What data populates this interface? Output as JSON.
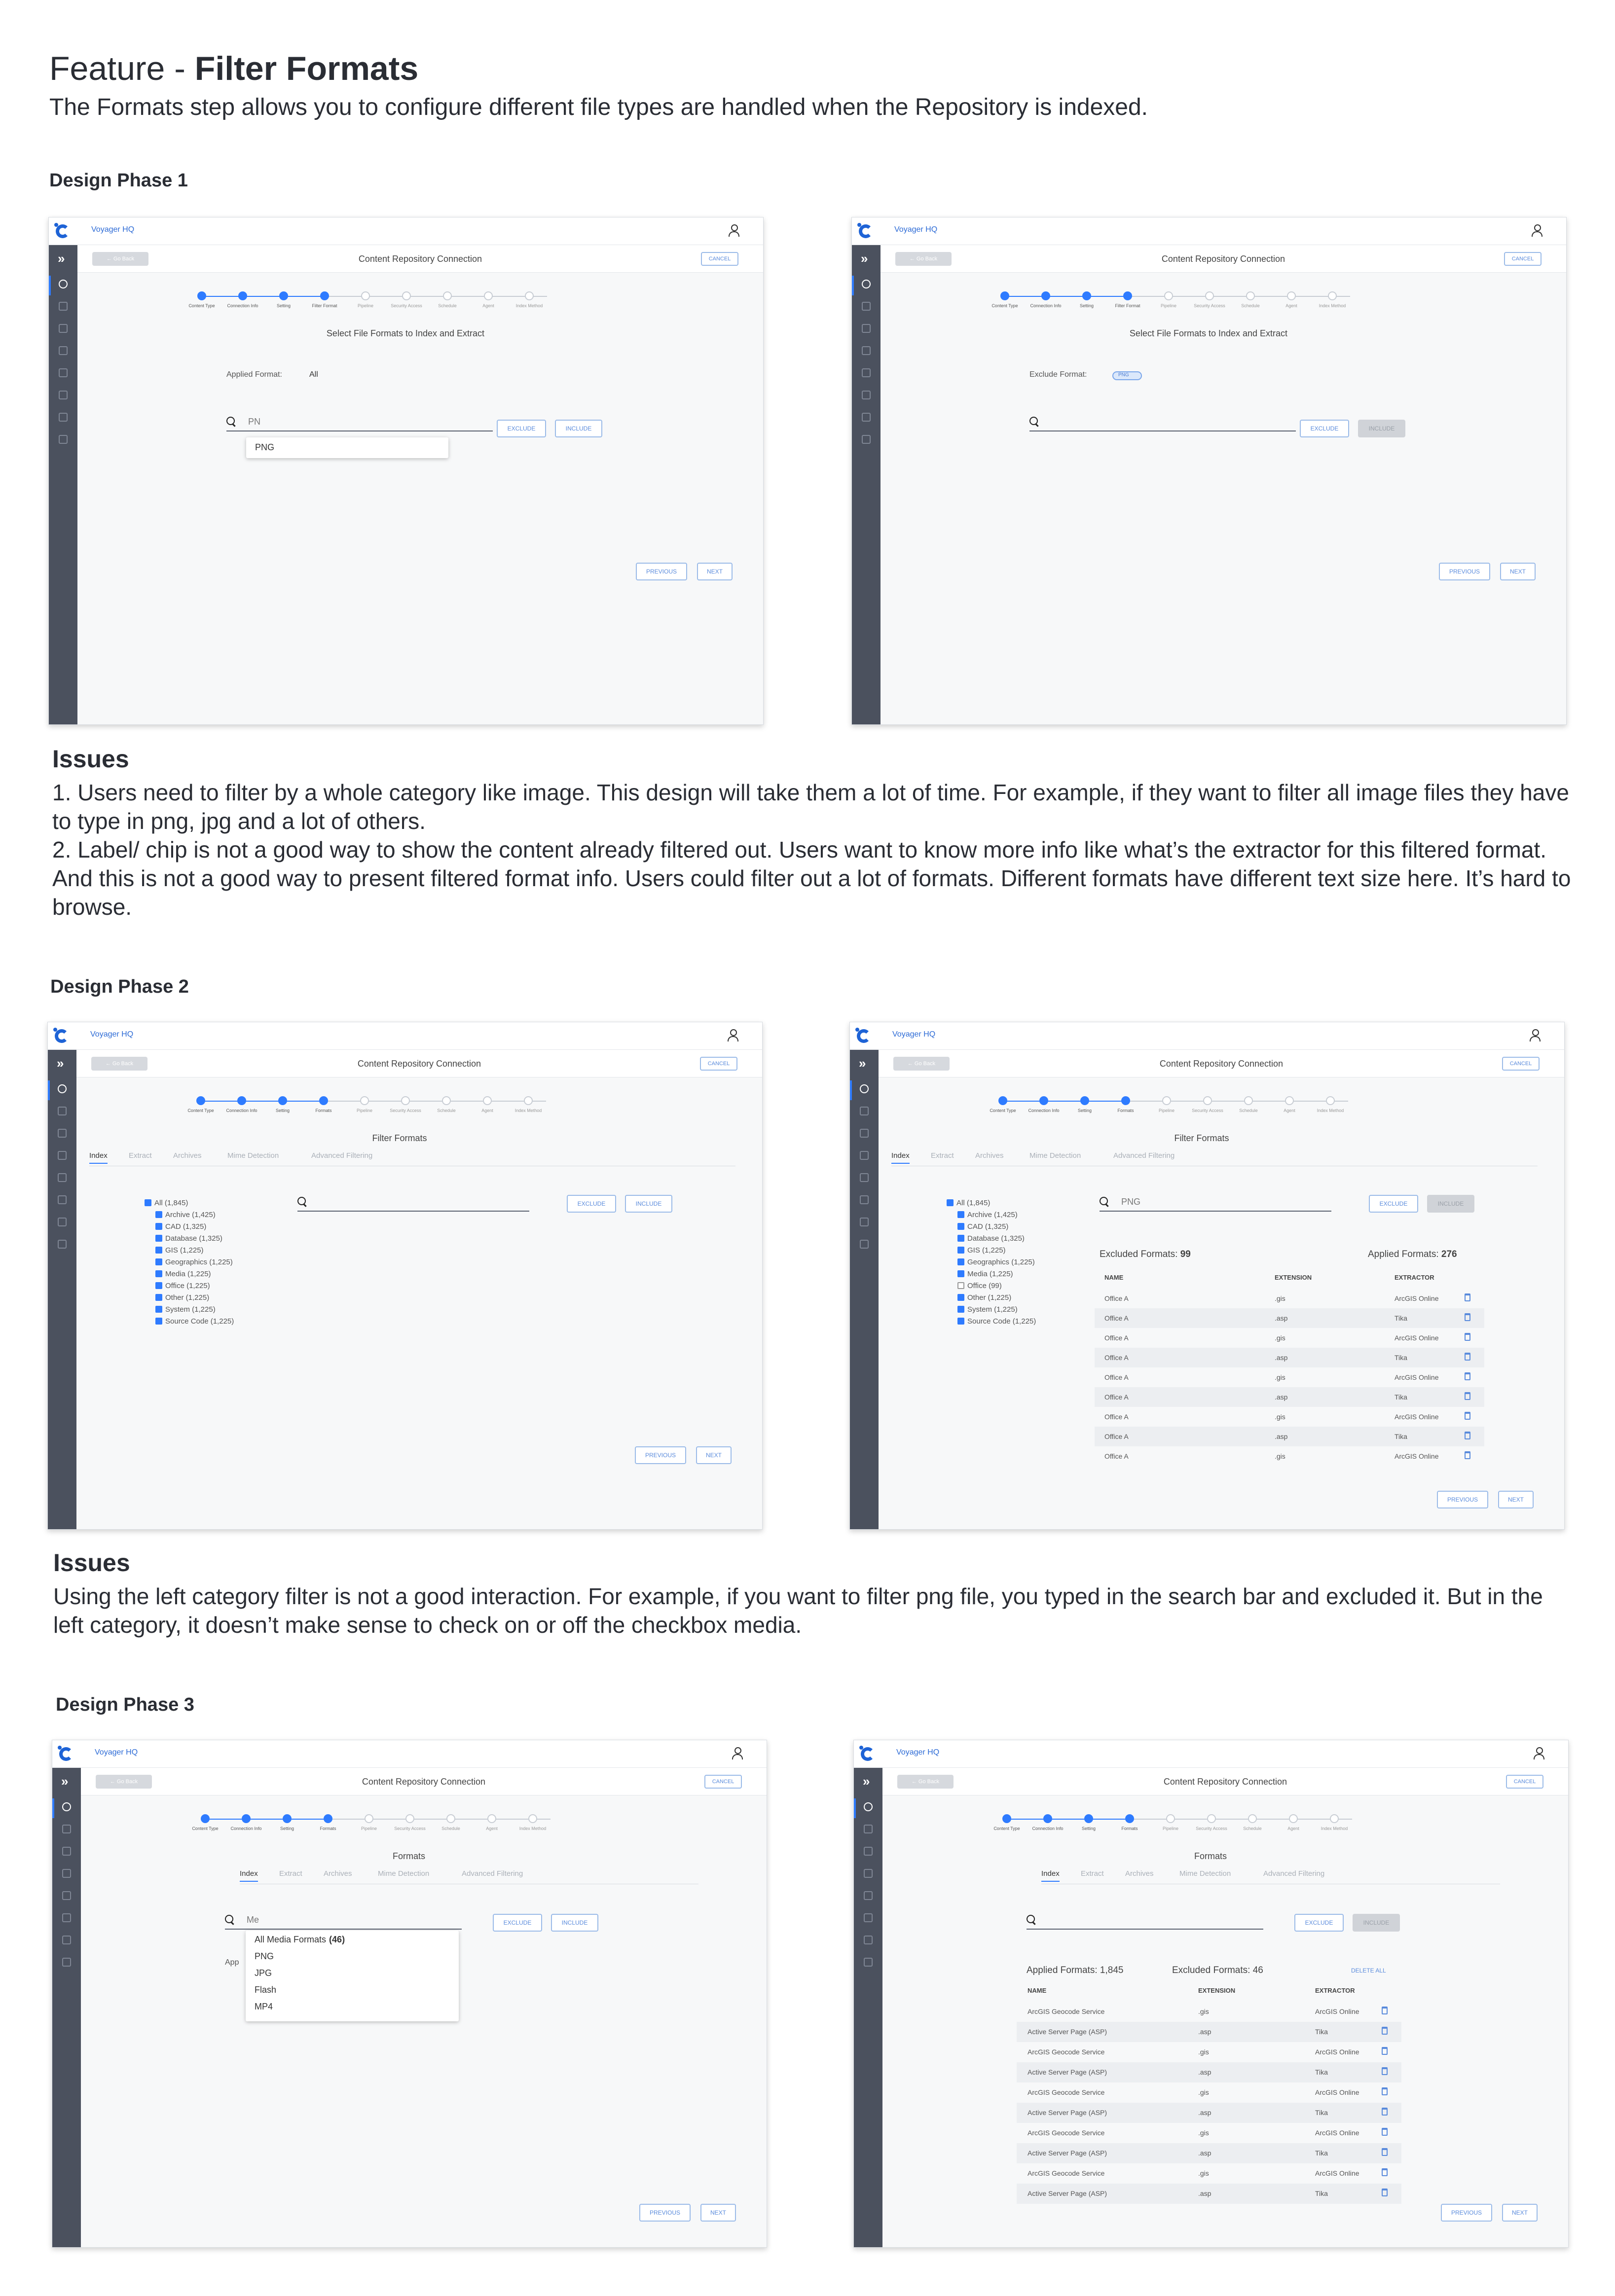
{
  "title_prefix": "Feature - ",
  "title_main": "Filter Formats",
  "intro": "The Formats step allows you to configure different file types are handled when the Repository is indexed.",
  "phase1_label": "Design Phase 1",
  "phase2_label": "Design Phase 2",
  "phase3_label": "Design Phase 3",
  "issues_label": "Issues",
  "issues1": [
    "1. Users need to filter by a whole category like image. This design will take them a lot of time. For example, if they want to filter all image files they have to type in png, jpg and a lot of others.",
    "2. Label/ chip is not a good way to show the content already filtered out. Users want to know more info like what’s the extractor for this filtered format. And this is not a good way to present filtered format info. Users could filter out a lot of formats. Different formats have different text size here. It’s hard to browse."
  ],
  "issues2": "Using the left category filter is not a good interaction. For example, if you want to filter png file, you typed in the search bar and excluded it. But in the left category, it doesn’t make sense to check on or off the checkbox media.",
  "app": {
    "brand": "Voyager HQ",
    "subtitle": "Content Repository Connection",
    "back": "← Go Back",
    "cancel": "CANCEL",
    "previous": "PREVIOUS",
    "next": "NEXT",
    "exclude": "EXCLUDE",
    "include": "INCLUDE",
    "steps_p1": [
      "Content Type",
      "Connection Info",
      "Setting",
      "Filter Format",
      "Pipeline",
      "Security Access",
      "Schedule",
      "Agent",
      "Index Method"
    ],
    "steps": [
      "Content Type",
      "Connection Info",
      "Setting",
      "Formats",
      "Pipeline",
      "Security Access",
      "Schedule",
      "Agent",
      "Index Method"
    ],
    "tabs": [
      "Index",
      "Extract",
      "Archives",
      "Mime Detection",
      "Advanced Filtering"
    ]
  },
  "p1a": {
    "heading": "Select File Formats to Index and Extract",
    "applied_label": "Applied Format:",
    "applied_value": "All",
    "search_value": "PN",
    "suggest": "PNG"
  },
  "p1b": {
    "heading": "Select File Formats to Index and Extract",
    "exclude_label": "Exclude Format:",
    "chip": "PNG"
  },
  "p2": {
    "heading": "Filter Formats",
    "categories_a": [
      "All (1,845)",
      "Archive (1,425)",
      "CAD (1,325)",
      "Database (1,325)",
      "GIS (1,225)",
      "Geographics (1,225)",
      "Media (1,225)",
      "Office (1,225)",
      "Other (1,225)",
      "System (1,225)",
      "Source Code (1,225)"
    ],
    "categories_b": [
      "All (1,845)",
      "Archive (1,425)",
      "CAD (1,325)",
      "Database (1,325)",
      "GIS (1,225)",
      "Geographics (1,225)",
      "Media (1,225)",
      "Office (99)",
      "Other (1,225)",
      "System (1,225)",
      "Source Code (1,225)"
    ],
    "search_b": "PNG",
    "excluded_label": "Excluded Formats:",
    "excluded_value": "99",
    "applied_label": "Applied Formats:",
    "applied_value": "276",
    "columns": [
      "NAME",
      "EXTENSION",
      "EXTRACTOR"
    ],
    "rows": [
      [
        "Office A",
        ".gis",
        "ArcGIS Online"
      ],
      [
        "Office A",
        ".asp",
        "Tika"
      ],
      [
        "Office A",
        ".gis",
        "ArcGIS Online"
      ],
      [
        "Office A",
        ".asp",
        "Tika"
      ],
      [
        "Office A",
        ".gis",
        "ArcGIS Online"
      ],
      [
        "Office A",
        ".asp",
        "Tika"
      ],
      [
        "Office A",
        ".gis",
        "ArcGIS Online"
      ],
      [
        "Office A",
        ".asp",
        "Tika"
      ],
      [
        "Office A",
        ".gis",
        "ArcGIS Online"
      ]
    ]
  },
  "p3": {
    "heading": "Formats",
    "search_a": "Me",
    "behind": "App",
    "menu": [
      "All Media Formats",
      "PNG",
      "JPG",
      "Flash",
      "MP4"
    ],
    "menu_count": "(46)",
    "applied_label": "Applied Formats:",
    "applied_value": "1,845",
    "excluded_label": "Excluded Formats:",
    "excluded_value": "46",
    "delete_all": "DELETE ALL",
    "columns": [
      "NAME",
      "EXTENSION",
      "EXTRACTOR"
    ],
    "rows": [
      [
        "ArcGIS Geocode Service",
        ".gis",
        "ArcGIS Online"
      ],
      [
        "Active Server Page (ASP)",
        ".asp",
        "Tika"
      ],
      [
        "ArcGIS Geocode Service",
        ".gis",
        "ArcGIS Online"
      ],
      [
        "Active Server Page (ASP)",
        ".asp",
        "Tika"
      ],
      [
        "ArcGIS Geocode Service",
        ".gis",
        "ArcGIS Online"
      ],
      [
        "Active Server Page (ASP)",
        ".asp",
        "Tika"
      ],
      [
        "ArcGIS Geocode Service",
        ".gis",
        "ArcGIS Online"
      ],
      [
        "Active Server Page (ASP)",
        ".asp",
        "Tika"
      ],
      [
        "ArcGIS Geocode Service",
        ".gis",
        "ArcGIS Online"
      ],
      [
        "Active Server Page (ASP)",
        ".asp",
        "Tika"
      ]
    ]
  },
  "colors": {
    "accent": "#2e7bff",
    "sidebar": "#4b515e",
    "brand": "#1e63d6"
  }
}
